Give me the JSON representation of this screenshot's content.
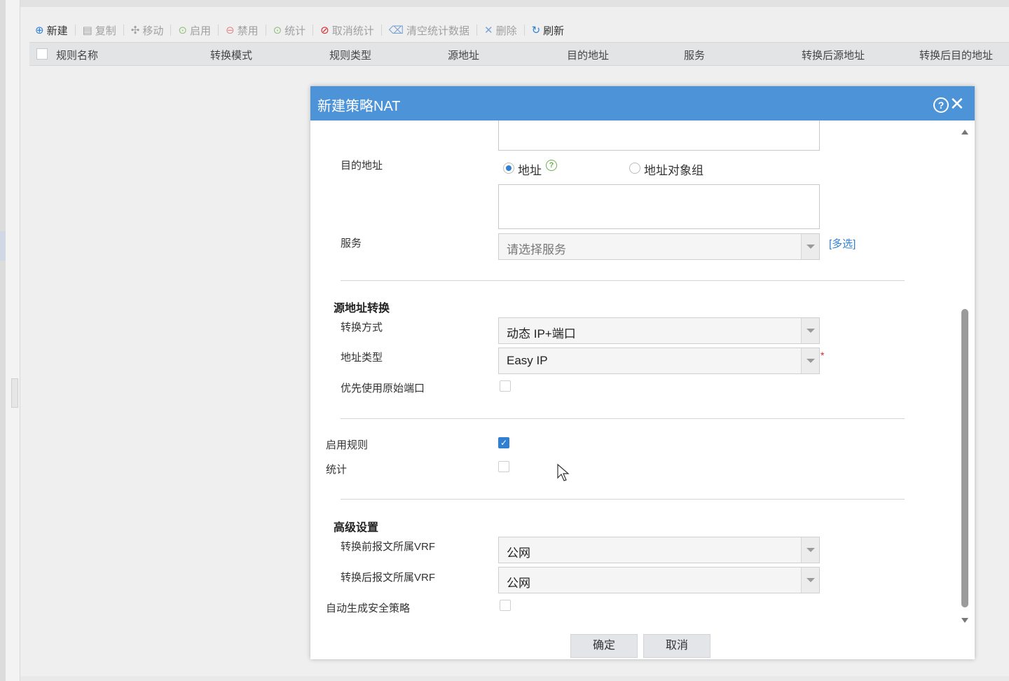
{
  "toolbar": {
    "items": [
      {
        "label": "新建",
        "icon": "plus-circle-icon",
        "enabled": true
      },
      {
        "label": "复制",
        "icon": "copy-icon",
        "enabled": false
      },
      {
        "label": "移动",
        "icon": "move-icon",
        "enabled": false
      },
      {
        "label": "启用",
        "icon": "play-circle-icon",
        "enabled": false
      },
      {
        "label": "禁用",
        "icon": "minus-circle-icon",
        "enabled": false
      },
      {
        "label": "统计",
        "icon": "play-circle-icon",
        "enabled": false
      },
      {
        "label": "取消统计",
        "icon": "ban-icon",
        "enabled": false
      },
      {
        "label": "清空统计数据",
        "icon": "eraser-icon",
        "enabled": false
      },
      {
        "label": "删除",
        "icon": "x-icon",
        "enabled": false
      },
      {
        "label": "刷新",
        "icon": "refresh-icon",
        "enabled": true
      }
    ]
  },
  "table": {
    "columns": [
      "规则名称",
      "转换模式",
      "规则类型",
      "源地址",
      "目的地址",
      "服务",
      "转换后源地址",
      "转换后目的地址"
    ]
  },
  "dialog": {
    "title": "新建策略NAT",
    "dest_address": {
      "label": "目的地址",
      "option_address": "地址",
      "option_group": "地址对象组",
      "selected": "地址"
    },
    "service": {
      "label": "服务",
      "placeholder": "请选择服务",
      "multi_link": "[多选]"
    },
    "src_translation": {
      "section": "源地址转换",
      "mode_label": "转换方式",
      "mode_value": "动态 IP+端口",
      "addr_type_label": "地址类型",
      "addr_type_value": "Easy IP",
      "prefer_port_label": "优先使用原始端口",
      "prefer_port_checked": false
    },
    "enable_rule": {
      "label": "启用规则",
      "checked": true
    },
    "stats": {
      "label": "统计",
      "checked": false
    },
    "advanced": {
      "section": "高级设置",
      "vrf_before_label": "转换前报文所属VRF",
      "vrf_before_value": "公网",
      "vrf_after_label": "转换后报文所属VRF",
      "vrf_after_value": "公网",
      "auto_policy_label": "自动生成安全策略",
      "auto_policy_checked": false
    },
    "ok": "确定",
    "cancel": "取消"
  },
  "colors": {
    "header_blue": "#4d93d8",
    "link_blue": "#2f7fd3",
    "help_green": "#6ab04c",
    "required_red": "#d9262c"
  }
}
